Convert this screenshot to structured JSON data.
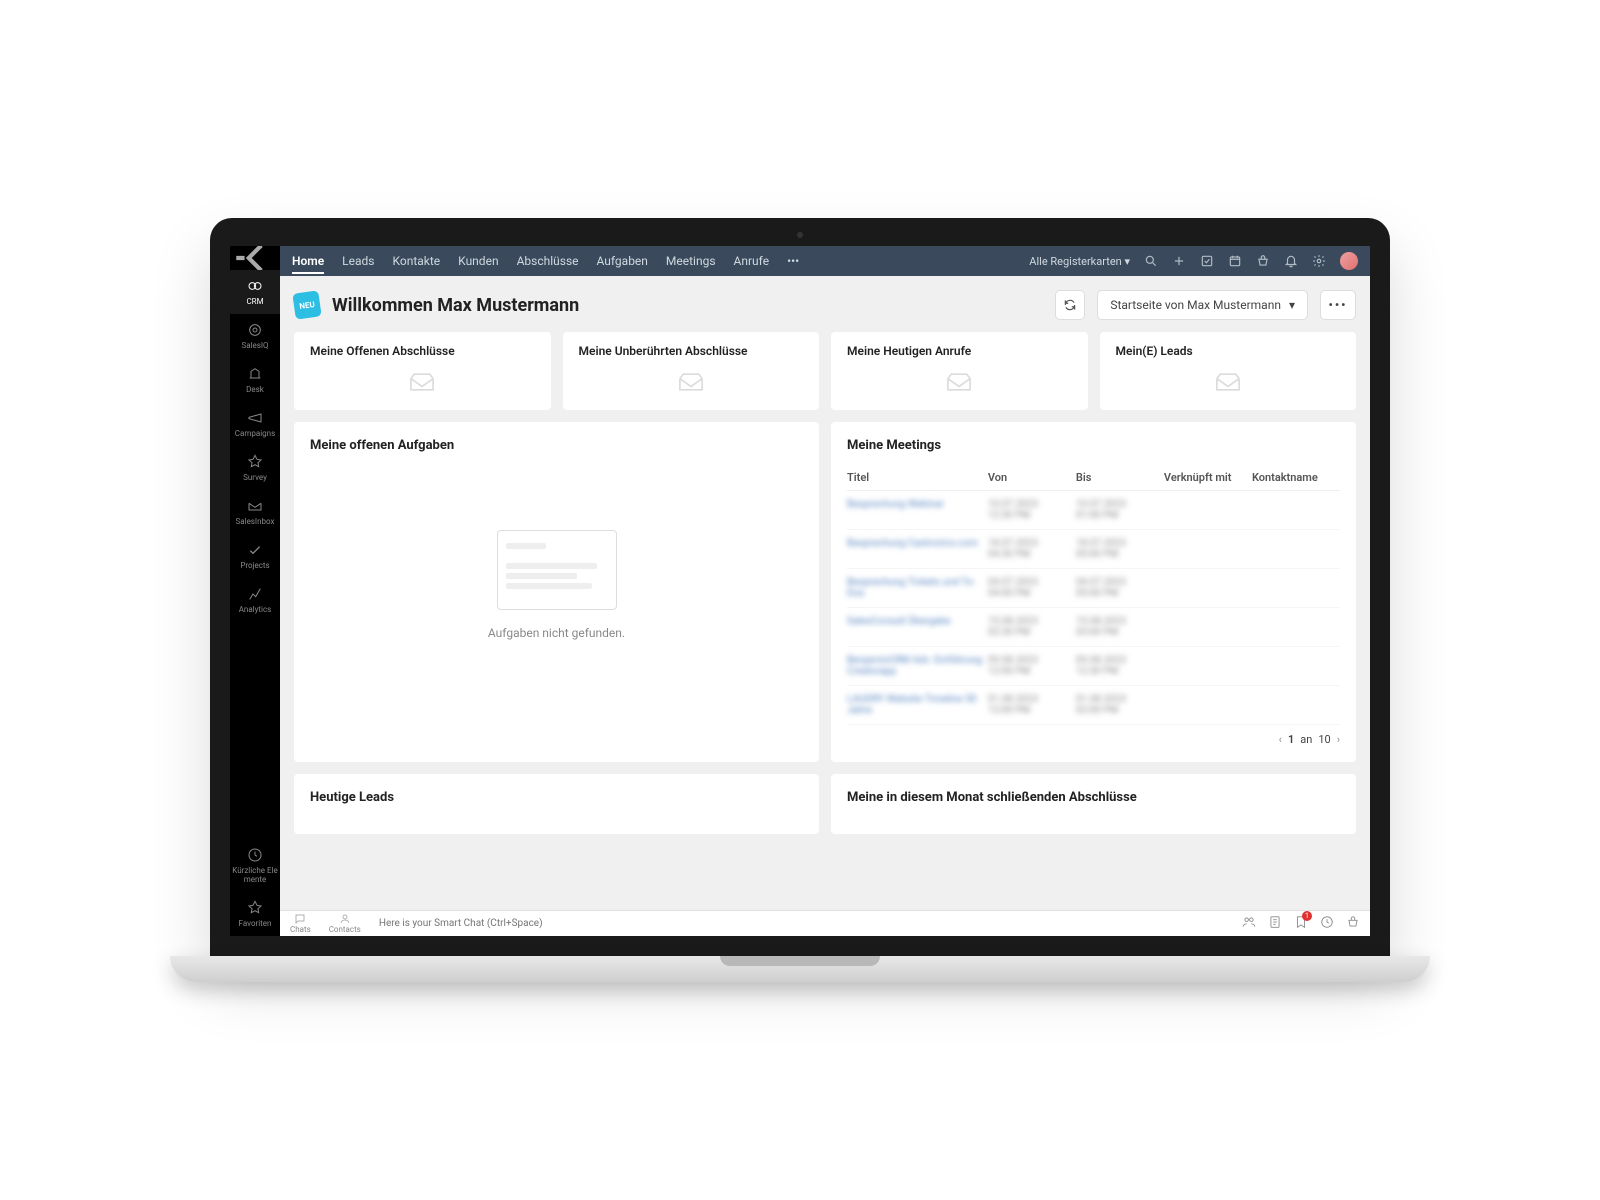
{
  "sidebar": {
    "items": [
      {
        "label": "CRM"
      },
      {
        "label": "SalesIQ"
      },
      {
        "label": "Desk"
      },
      {
        "label": "Campaigns"
      },
      {
        "label": "Survey"
      },
      {
        "label": "SalesInbox"
      },
      {
        "label": "Projects"
      },
      {
        "label": "Analytics"
      }
    ],
    "bottom": [
      {
        "label": "Kürzliche Ele\nmente"
      },
      {
        "label": "Favoriten"
      }
    ]
  },
  "topnav": {
    "items": [
      "Home",
      "Leads",
      "Kontakte",
      "Kunden",
      "Abschlüsse",
      "Aufgaben",
      "Meetings",
      "Anrufe"
    ],
    "more": "•••",
    "all_tabs": "Alle Registerkarten"
  },
  "header": {
    "badge": "NEU",
    "welcome": "Willkommen Max Mustermann",
    "dropdown": "Startseite von Max Mustermann",
    "more": "•••"
  },
  "stats": [
    {
      "title": "Meine Offenen Abschlüsse"
    },
    {
      "title": "Meine Unberührten Abschlüsse"
    },
    {
      "title": "Meine Heutigen Anrufe"
    },
    {
      "title": "Mein(E) Leads"
    }
  ],
  "tasks": {
    "title": "Meine offenen Aufgaben",
    "empty": "Aufgaben nicht gefunden."
  },
  "meetings": {
    "title": "Meine Meetings",
    "cols": {
      "title": "Titel",
      "von": "Von",
      "bis": "Bis",
      "link": "Verknüpft mit",
      "contact": "Kontaktname"
    },
    "rows": [
      {
        "t": "Besprechung Webinar",
        "v1": "10.07.2023",
        "v2": "12:30 PM",
        "b1": "10.07.2023",
        "b2": "01:00 PM"
      },
      {
        "t": "Besprechung Castronics.com",
        "v1": "18.07.2023",
        "v2": "04:30 PM",
        "b1": "18.07.2023",
        "b2": "05:00 PM"
      },
      {
        "t": "Besprechung Tickets und To-Dos",
        "v1": "04.07.2023",
        "v2": "04:00 PM",
        "b1": "04.07.2023",
        "b2": "05:00 PM"
      },
      {
        "t": "SalesConsult Übergabe",
        "v1": "15.08.2023",
        "v2": "02:30 PM",
        "b1": "15.08.2023",
        "b2": "03:00 PM"
      },
      {
        "t": "BenjaminCRM Adv. Einführung Creatorapp",
        "v1": "09.08.2023",
        "v2": "12:00 PM",
        "b1": "09.08.2023",
        "b2": "12:30 PM"
      },
      {
        "t": "LAUDRY Website Timeline 50 Jahre",
        "v1": "01.08.2023",
        "v2": "12:00 PM",
        "b1": "01.08.2023",
        "b2": "02:00 PM"
      }
    ],
    "pagination": {
      "page": "1",
      "sep": "an",
      "total": "10"
    }
  },
  "leads_today": {
    "title": "Heutige Leads"
  },
  "closing_month": {
    "title": "Meine in diesem Monat schließenden Abschlüsse"
  },
  "bottombar": {
    "chats": "Chats",
    "contacts": "Contacts",
    "placeholder": "Here is your Smart Chat (Ctrl+Space)",
    "badge_count": "1"
  }
}
